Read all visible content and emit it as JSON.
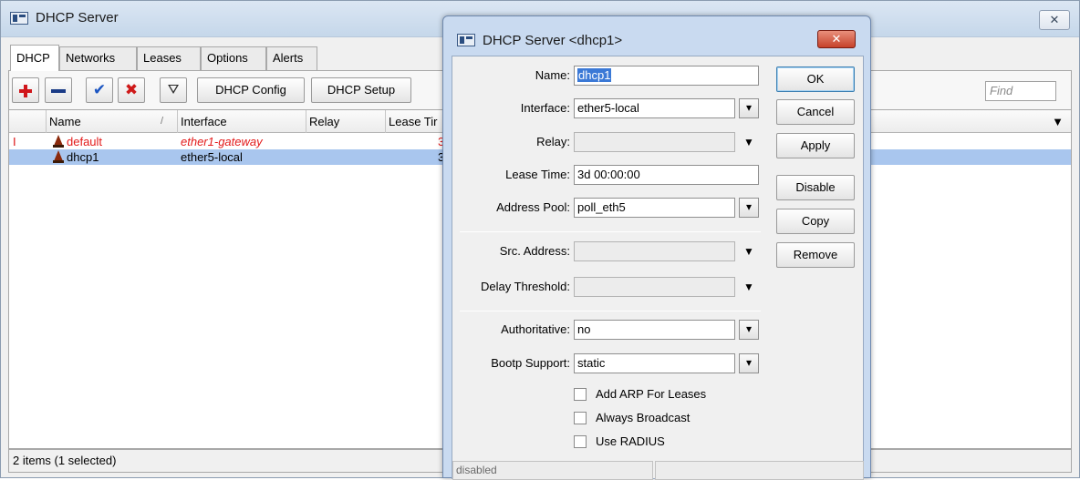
{
  "main_window": {
    "title": "DHCP Server",
    "close_glyph": "✕",
    "tabs": [
      {
        "label": "DHCP"
      },
      {
        "label": "Networks"
      },
      {
        "label": "Leases"
      },
      {
        "label": "Options"
      },
      {
        "label": "Alerts"
      }
    ],
    "toolbar": {
      "add_icon": "plus-icon",
      "remove_icon": "minus-icon",
      "enable_glyph": "✔",
      "disable_glyph": "✖",
      "filter_glyph": "⛛",
      "dhcp_config_label": "DHCP Config",
      "dhcp_setup_label": "DHCP Setup",
      "find_placeholder": "Find"
    },
    "list": {
      "columns": [
        "Name",
        "Interface",
        "Relay",
        "Lease Tir"
      ],
      "sort_glyph": "/",
      "dropdown_glyph": "▼",
      "rows": [
        {
          "flag": "I",
          "name": "default",
          "interface": "ether1-gateway",
          "relay": "",
          "lease": "3",
          "invalid": true,
          "selected": false
        },
        {
          "flag": "",
          "name": "dhcp1",
          "interface": "ether5-local",
          "relay": "",
          "lease": "3",
          "invalid": false,
          "selected": true
        }
      ]
    },
    "status": "2 items (1 selected)"
  },
  "dialog": {
    "title": "DHCP Server <dhcp1>",
    "close_glyph": "✕",
    "fields": {
      "name": {
        "label": "Name:",
        "value": "dhcp1"
      },
      "interface": {
        "label": "Interface:",
        "value": "ether5-local"
      },
      "relay": {
        "label": "Relay:",
        "value": ""
      },
      "lease_time": {
        "label": "Lease Time:",
        "value": "3d 00:00:00"
      },
      "address_pool": {
        "label": "Address Pool:",
        "value": "poll_eth5"
      },
      "src_address": {
        "label": "Src. Address:",
        "value": ""
      },
      "delay_threshold": {
        "label": "Delay Threshold:",
        "value": ""
      },
      "authoritative": {
        "label": "Authoritative:",
        "value": "no"
      },
      "bootp_support": {
        "label": "Bootp Support:",
        "value": "static"
      }
    },
    "checkboxes": {
      "add_arp": {
        "label": "Add ARP For Leases",
        "checked": false
      },
      "always_broadcast": {
        "label": "Always Broadcast",
        "checked": false
      },
      "use_radius": {
        "label": "Use RADIUS",
        "checked": false
      }
    },
    "buttons": {
      "ok": "OK",
      "cancel": "Cancel",
      "apply": "Apply",
      "disable": "Disable",
      "copy": "Copy",
      "remove": "Remove"
    },
    "dropdown_glyph": "▼",
    "select_glyph": "▾",
    "status": "disabled"
  }
}
